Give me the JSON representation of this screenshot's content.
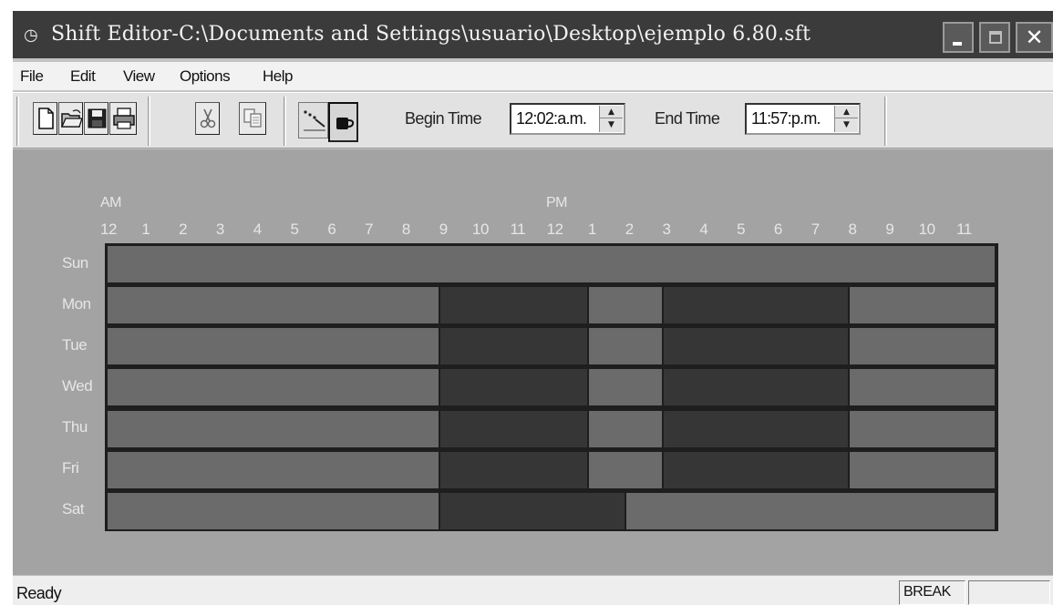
{
  "window": {
    "title": "Shift Editor-C:\\Documents and Settings\\usuario\\Desktop\\ejemplo 6.80.sft",
    "app_icon": "clock-icon"
  },
  "menu": [
    "File",
    "Edit",
    "View",
    "Options",
    "Help"
  ],
  "toolbar": {
    "buttons": [
      "new-file-icon",
      "open-folder-icon",
      "save-icon",
      "print-icon",
      "cut-icon",
      "copy-icon"
    ],
    "mode_toggle": {
      "work_icon": "work-tool-icon",
      "break_icon": "coffee-cup-icon",
      "selected": "break"
    },
    "begin_time_label": "Begin Time",
    "begin_time_value": "12:02:a.m.",
    "end_time_label": "End Time",
    "end_time_value": "11:57:p.m."
  },
  "schedule": {
    "am_label": "AM",
    "pm_label": "PM",
    "hours": [
      "12",
      "1",
      "2",
      "3",
      "4",
      "5",
      "6",
      "7",
      "8",
      "9",
      "10",
      "11",
      "12",
      "1",
      "2",
      "3",
      "4",
      "5",
      "6",
      "7",
      "8",
      "9",
      "10",
      "11"
    ],
    "days": [
      {
        "label": "Sun",
        "segments": [
          {
            "start": 0,
            "end": 24,
            "type": "off"
          }
        ]
      },
      {
        "label": "Mon",
        "segments": [
          {
            "start": 0,
            "end": 9,
            "type": "off"
          },
          {
            "start": 9,
            "end": 13,
            "type": "work"
          },
          {
            "start": 13,
            "end": 15,
            "type": "break"
          },
          {
            "start": 15,
            "end": 20,
            "type": "work"
          },
          {
            "start": 20,
            "end": 24,
            "type": "off"
          }
        ]
      },
      {
        "label": "Tue",
        "segments": [
          {
            "start": 0,
            "end": 9,
            "type": "off"
          },
          {
            "start": 9,
            "end": 13,
            "type": "work"
          },
          {
            "start": 13,
            "end": 15,
            "type": "break"
          },
          {
            "start": 15,
            "end": 20,
            "type": "work"
          },
          {
            "start": 20,
            "end": 24,
            "type": "off"
          }
        ]
      },
      {
        "label": "Wed",
        "segments": [
          {
            "start": 0,
            "end": 9,
            "type": "off"
          },
          {
            "start": 9,
            "end": 13,
            "type": "work"
          },
          {
            "start": 13,
            "end": 15,
            "type": "break"
          },
          {
            "start": 15,
            "end": 20,
            "type": "work"
          },
          {
            "start": 20,
            "end": 24,
            "type": "off"
          }
        ]
      },
      {
        "label": "Thu",
        "segments": [
          {
            "start": 0,
            "end": 9,
            "type": "off"
          },
          {
            "start": 9,
            "end": 13,
            "type": "work"
          },
          {
            "start": 13,
            "end": 15,
            "type": "break"
          },
          {
            "start": 15,
            "end": 20,
            "type": "work"
          },
          {
            "start": 20,
            "end": 24,
            "type": "off"
          }
        ]
      },
      {
        "label": "Fri",
        "segments": [
          {
            "start": 0,
            "end": 9,
            "type": "off"
          },
          {
            "start": 9,
            "end": 13,
            "type": "work"
          },
          {
            "start": 13,
            "end": 15,
            "type": "break"
          },
          {
            "start": 15,
            "end": 20,
            "type": "work"
          },
          {
            "start": 20,
            "end": 24,
            "type": "off"
          }
        ]
      },
      {
        "label": "Sat",
        "segments": [
          {
            "start": 0,
            "end": 9,
            "type": "off"
          },
          {
            "start": 9,
            "end": 14,
            "type": "work"
          },
          {
            "start": 14,
            "end": 24,
            "type": "off"
          }
        ]
      }
    ],
    "colors": {
      "off": "#6b6b6b",
      "break": "#6b6b6b",
      "work": "#363636",
      "gridline": "#1e1e1e"
    }
  },
  "status": {
    "text": "Ready",
    "mode_panel": "BREAK",
    "extra_panel": ""
  }
}
